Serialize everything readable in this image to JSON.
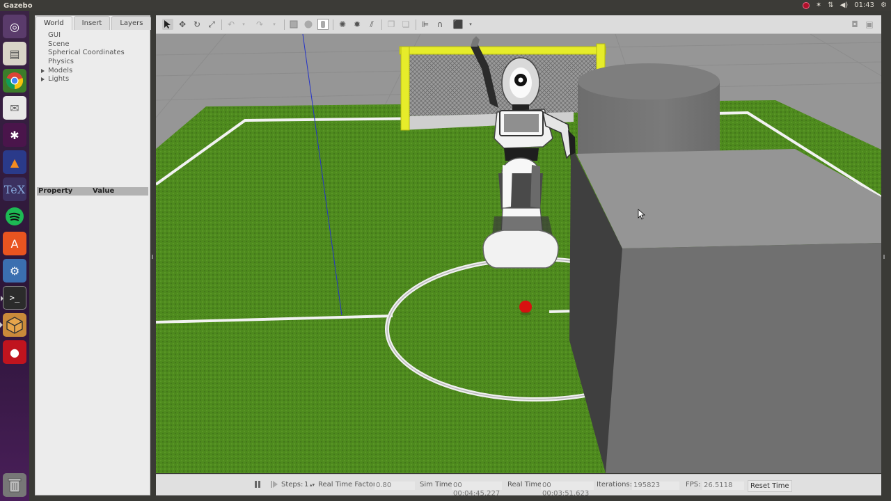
{
  "window": {
    "title": "Gazebo"
  },
  "system": {
    "clock": "01:43"
  },
  "launcher": {
    "items": [
      {
        "name": "ubuntu-dash",
        "glyph": "◎"
      },
      {
        "name": "files",
        "glyph": "▤"
      },
      {
        "name": "chrome",
        "glyph": "◉"
      },
      {
        "name": "mail",
        "glyph": "✉"
      },
      {
        "name": "slack",
        "glyph": "✱"
      },
      {
        "name": "matlab",
        "glyph": "▲"
      },
      {
        "name": "texmaker",
        "glyph": "T"
      },
      {
        "name": "spotify",
        "glyph": "≋"
      },
      {
        "name": "software-center",
        "glyph": "A"
      },
      {
        "name": "settings",
        "glyph": "⚙"
      },
      {
        "name": "terminal",
        "glyph": ">_"
      },
      {
        "name": "virtualbox",
        "glyph": "⬡"
      },
      {
        "name": "recorder",
        "glyph": "●"
      },
      {
        "name": "trash",
        "glyph": "🗑"
      }
    ]
  },
  "left_panel": {
    "tabs": [
      "World",
      "Insert",
      "Layers"
    ],
    "selected_tab": "World",
    "tree": [
      {
        "label": "GUI",
        "expandable": false
      },
      {
        "label": "Scene",
        "expandable": false
      },
      {
        "label": "Spherical Coordinates",
        "expandable": false
      },
      {
        "label": "Physics",
        "expandable": false
      },
      {
        "label": "Models",
        "expandable": true
      },
      {
        "label": "Lights",
        "expandable": true
      }
    ],
    "property_header": "Property",
    "value_header": "Value"
  },
  "bottom_bar": {
    "steps_label": "Steps:",
    "steps_value": "1",
    "rtf_label": "Real Time Factor:",
    "rtf_value": "0.80",
    "sim_time_label": "Sim Time:",
    "sim_time_value": "00 00:04:45.227",
    "real_time_label": "Real Time:",
    "real_time_value": "00 00:03:51.623",
    "iterations_label": "Iterations:",
    "iterations_value": "195823",
    "fps_label": "FPS:",
    "fps_value": "26.5118",
    "reset_label": "Reset Time"
  },
  "colors": {
    "grass": "#4f8a1f",
    "goal_post": "#e6ec2a",
    "obstacle": "#6f6f6f",
    "ball": "#d81010"
  }
}
